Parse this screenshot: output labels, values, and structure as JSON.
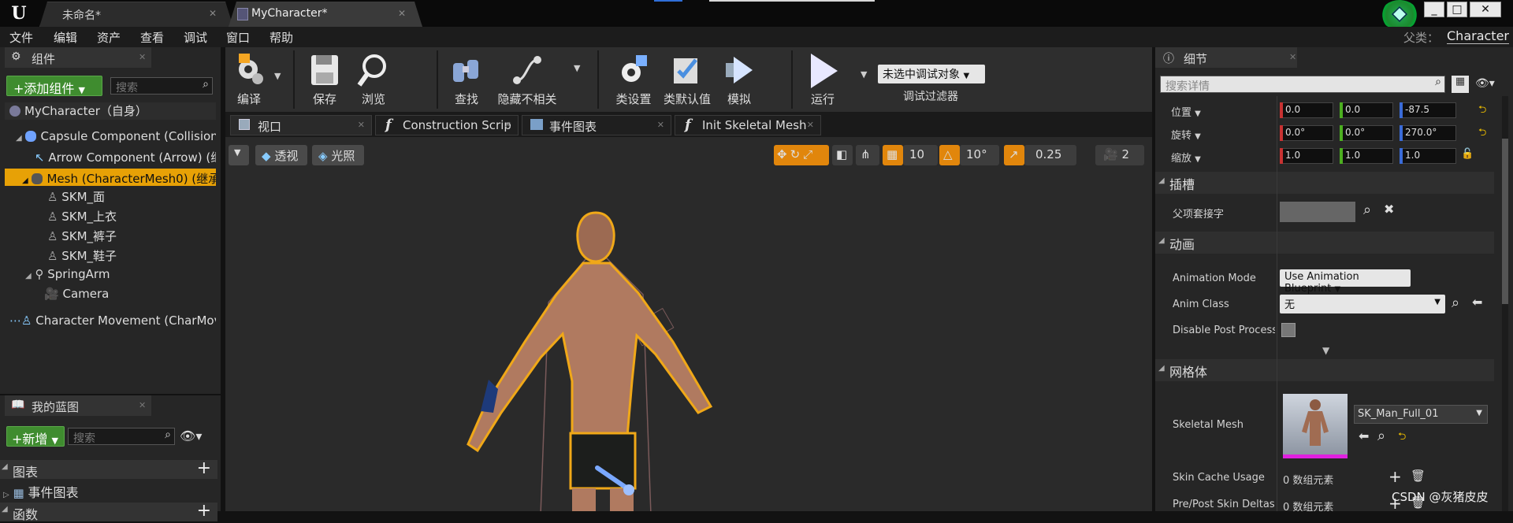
{
  "tabs": [
    {
      "label": "未命名*"
    },
    {
      "label": "MyCharacter*"
    }
  ],
  "window_buttons": [
    "_",
    "□",
    "✕"
  ],
  "menu": [
    "文件",
    "编辑",
    "资产",
    "查看",
    "调试",
    "窗口",
    "帮助"
  ],
  "parent": {
    "label": "父类：",
    "value": "Character"
  },
  "components": {
    "title": "组件",
    "add_button": "+添加组件",
    "search_placeholder": "搜索",
    "self": "MyCharacter（自身）",
    "items": [
      "Capsule Component (CollisionC",
      "Arrow Component (Arrow) (继承",
      "Mesh (CharacterMesh0) (继承)",
      "SKM_面",
      "SKM_上衣",
      "SKM_裤子",
      "SKM_鞋子",
      "SpringArm",
      "Camera",
      "Character Movement (CharMove"
    ]
  },
  "blueprint": {
    "title": "我的蓝图",
    "new_button": "+新增",
    "search_placeholder": "搜索",
    "sections": [
      "图表",
      "事件图表",
      "函数"
    ]
  },
  "toolbar": {
    "items": [
      "编译",
      "保存",
      "浏览",
      "查找",
      "隐藏不相关",
      "类设置",
      "类默认值",
      "模拟",
      "运行"
    ],
    "debug_select": "未选中调试对象",
    "debug_filter": "调试过滤器"
  },
  "editor_tabs": [
    "视口",
    "Construction Scrip",
    "事件图表",
    "Init Skeletal Mesh"
  ],
  "viewport": {
    "perspective": "透视",
    "lighting": "光照",
    "grid_snap": "10",
    "rot_snap": "10°",
    "scale_snap": "0.25",
    "cam_speed": "2"
  },
  "details": {
    "title": "细节",
    "search_placeholder": "搜索详情",
    "location": {
      "label": "位置",
      "x": "0.0",
      "y": "0.0",
      "z": "-87.5"
    },
    "rotation": {
      "label": "旋转",
      "x": "0.0°",
      "y": "0.0°",
      "z": "270.0°"
    },
    "scale": {
      "label": "缩放",
      "x": "1.0",
      "y": "1.0",
      "z": "1.0"
    },
    "socket_section": "插槽",
    "parent_socket": "父项套接字",
    "anim_section": "动画",
    "anim_mode_label": "Animation Mode",
    "anim_mode_value": "Use Animation Blueprint",
    "anim_class_label": "Anim Class",
    "anim_class_value": "无",
    "disable_post": "Disable Post Process B",
    "mesh_section": "网格体",
    "skeletal_mesh_label": "Skeletal Mesh",
    "skeletal_mesh_value": "SK_Man_Full_01",
    "skin_cache_label": "Skin Cache Usage",
    "skin_cache_value": "0 数组元素",
    "prepost_label": "Pre/Post Skin Deltas U",
    "prepost_value": "0 数组元素"
  },
  "watermark": "CSDN @灰猪皮皮"
}
